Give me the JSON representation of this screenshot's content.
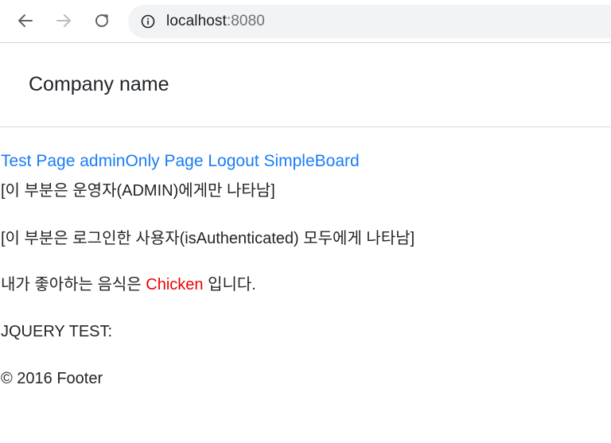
{
  "browser": {
    "url_host": "localhost",
    "url_port": ":8080"
  },
  "header": {
    "brand": "Company name"
  },
  "nav": {
    "links": [
      "Test Page",
      "adminOnly Page",
      "Logout",
      "SimpleBoard"
    ]
  },
  "content": {
    "admin_notice": "[이 부분은 운영자(ADMIN)에게만 나타남]",
    "auth_notice": "[이 부분은 로그인한 사용자(isAuthenticated) 모두에게 나타남]",
    "food_prefix": "내가 좋아하는 음식은 ",
    "food_value": "Chicken",
    "food_suffix": " 입니다.",
    "jquery_label": "JQUERY TEST:",
    "footer": "© 2016 Footer"
  },
  "colors": {
    "link": "#1a7cf5",
    "highlight": "#ee0000",
    "text": "#212529"
  },
  "icons": {
    "back": "arrow-left-icon",
    "forward": "arrow-right-icon",
    "reload": "reload-icon",
    "info": "info-icon"
  }
}
